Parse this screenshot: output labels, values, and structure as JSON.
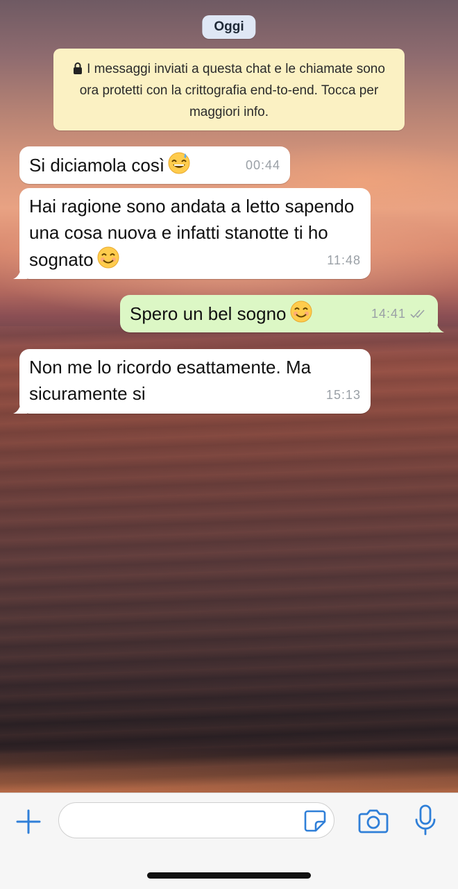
{
  "chat": {
    "date_label": "Oggi",
    "encryption_notice": "I messaggi inviati a questa chat e le chiamate sono ora protetti con la crittografia end-to-end. Tocca per maggiori info.",
    "messages": [
      {
        "direction": "incoming",
        "text": "Si diciamola così",
        "emoji": "sweat-smile",
        "time": "00:44"
      },
      {
        "direction": "incoming",
        "text": "Hai ragione sono andata a letto sapendo una cosa nuova e infatti stanotte ti ho sognato",
        "emoji": "smile",
        "time": "11:48"
      },
      {
        "direction": "outgoing",
        "text": "Spero un bel sogno",
        "emoji": "smile",
        "time": "14:41",
        "status": "read"
      },
      {
        "direction": "incoming",
        "text": "Non me lo ricordo esattamente. Ma sicuramente si",
        "time": "15:13"
      }
    ]
  },
  "input_bar": {
    "message_value": "",
    "icons": [
      "plus-icon",
      "sticker-icon",
      "camera-icon",
      "microphone-icon"
    ],
    "accent_color": "#2f7fd8"
  },
  "colors": {
    "incoming_bubble": "#ffffff",
    "outgoing_bubble": "#dcf7c5",
    "notice_bg": "#fbf1c3",
    "date_pill_bg": "#dfe7f5"
  }
}
